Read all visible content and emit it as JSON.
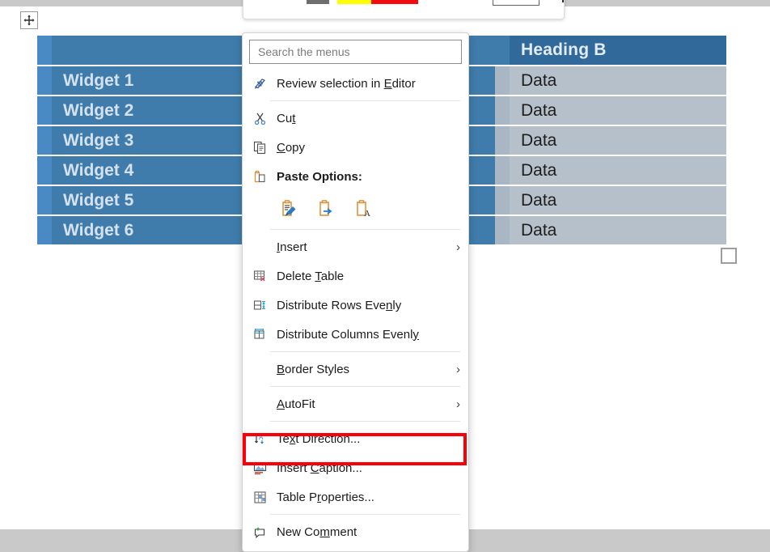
{
  "window": {
    "background_color": "#c9c9c9",
    "page_color": "#ffffff"
  },
  "mini_toolbar": {
    "name": "floating-mini-toolbar",
    "swatches": [
      {
        "name": "no-color-swatch",
        "color": "#6e6e6e"
      },
      {
        "name": "yellow-highlight-swatch",
        "color": "#ffff00"
      },
      {
        "name": "red-shading-swatch",
        "color": "#f40c0c"
      }
    ]
  },
  "table": {
    "name": "widget-table",
    "move_handle_icon": "move-cross-icon",
    "resize_handle_icon": "resize-handle-icon",
    "header": {
      "col_a": "",
      "col_b": "Heading B"
    },
    "rows": [
      {
        "col_a": "Widget 1",
        "col_b": "Data"
      },
      {
        "col_a": "Widget 2",
        "col_b": "Data"
      },
      {
        "col_a": "Widget 3",
        "col_b": "Data"
      },
      {
        "col_a": "Widget 4",
        "col_b": "Data"
      },
      {
        "col_a": "Widget 5",
        "col_b": "Data"
      },
      {
        "col_a": "Widget 6",
        "col_b": "Data"
      }
    ],
    "colors": {
      "header_left": "#3f7cab",
      "header_right": "#31699b",
      "selected_left": "#3f7cab",
      "selected_right": "#b6c0cb",
      "strip": "#4a8ac4"
    }
  },
  "context_menu": {
    "name": "table-context-menu",
    "search": {
      "placeholder": "Search the menus",
      "value": "",
      "icon": "search-menus-input"
    },
    "items": [
      {
        "id": "review-selection-in-editor",
        "label": "Review selection in Editor",
        "label_html": "Review selection in <u>E</u>ditor",
        "icon": "editor-pen-icon",
        "submenu": false
      },
      {
        "id": "cut",
        "label": "Cut",
        "label_html": "Cu<u>t</u>",
        "icon": "scissors-icon",
        "submenu": false
      },
      {
        "id": "copy",
        "label": "Copy",
        "label_html": "<u>C</u>opy",
        "icon": "copy-pages-icon",
        "submenu": false
      },
      {
        "id": "paste-options",
        "label": "Paste Options:",
        "label_html": "Paste Options:",
        "icon": "clipboard-icon",
        "bold": true,
        "submenu": false
      },
      {
        "id": "insert",
        "label": "Insert",
        "label_html": "<u>I</u>nsert",
        "icon": "",
        "submenu": true
      },
      {
        "id": "delete-table",
        "label": "Delete Table",
        "label_html": "Delete <u>T</u>able",
        "icon": "delete-table-icon",
        "submenu": false
      },
      {
        "id": "distribute-rows-evenly",
        "label": "Distribute Rows Evenly",
        "label_html": "Distribute Rows Eve<u>n</u>ly",
        "icon": "distribute-rows-icon",
        "submenu": false
      },
      {
        "id": "distribute-columns-evenly",
        "label": "Distribute Columns Evenly",
        "label_html": "Distribute Columns Evenl<u>y</u>",
        "icon": "distribute-columns-icon",
        "submenu": false
      },
      {
        "id": "border-styles",
        "label": "Border Styles",
        "label_html": "<u>B</u>order Styles",
        "icon": "",
        "submenu": true
      },
      {
        "id": "autofit",
        "label": "AutoFit",
        "label_html": "<u>A</u>utoFit",
        "icon": "",
        "submenu": true
      },
      {
        "id": "text-direction",
        "label": "Text Direction...",
        "label_html": "Te<u>x</u>t Direction...",
        "icon": "text-direction-icon",
        "submenu": false
      },
      {
        "id": "insert-caption",
        "label": "Insert Caption...",
        "label_html": "Insert <u>C</u>aption...",
        "icon": "insert-caption-picture-icon",
        "submenu": false,
        "highlighted": true,
        "highlight_color": "#fb0007"
      },
      {
        "id": "table-properties",
        "label": "Table Properties...",
        "label_html": "Table P<u>r</u>operties...",
        "icon": "table-properties-icon",
        "submenu": false
      },
      {
        "id": "new-comment",
        "label": "New Comment",
        "label_html": "New Co<u>m</u>ment",
        "icon": "new-comment-icon",
        "submenu": false
      }
    ],
    "paste_options": [
      {
        "id": "keep-source-formatting",
        "icon": "paste-keep-source-formatting-icon"
      },
      {
        "id": "merge-formatting",
        "icon": "paste-merge-formatting-icon"
      },
      {
        "id": "keep-text-only",
        "icon": "paste-keep-text-only-icon"
      }
    ]
  }
}
